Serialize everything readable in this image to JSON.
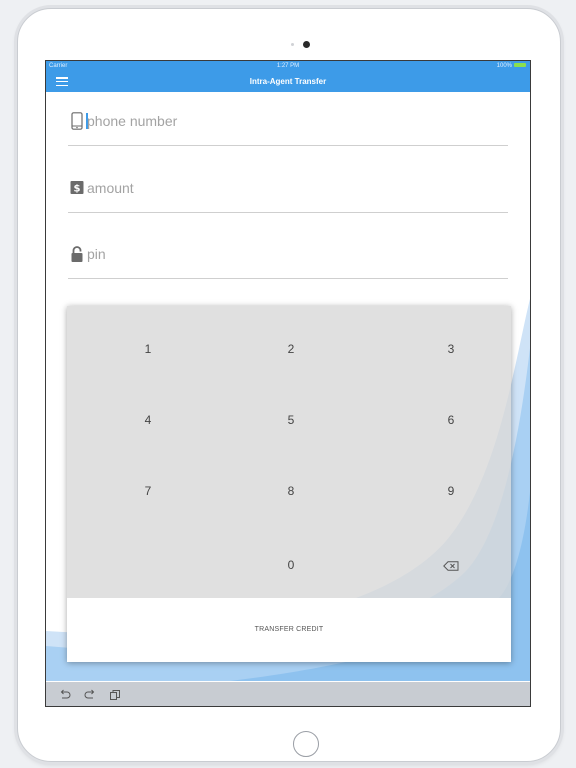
{
  "status_bar": {
    "carrier": "Carrier",
    "time": "1:27 PM",
    "battery": "100%"
  },
  "nav": {
    "title": "Intra-Agent Transfer",
    "menu_icon": "hamburger-menu-icon"
  },
  "form": {
    "phone": {
      "placeholder": "phone number",
      "value": "",
      "icon": "mobile-phone-icon"
    },
    "amount": {
      "placeholder": "amount",
      "value": "",
      "icon": "dollar-sign-icon"
    },
    "pin": {
      "placeholder": "pin",
      "value": "",
      "icon": "lock-icon"
    }
  },
  "keypad": {
    "keys": [
      "1",
      "2",
      "3",
      "4",
      "5",
      "6",
      "7",
      "8",
      "9",
      "0"
    ],
    "backspace_icon": "backspace-icon"
  },
  "transfer": {
    "label": "TRANSFER CREDIT"
  },
  "toolbar": {
    "icons": [
      "undo-icon",
      "redo-icon",
      "paste-icon"
    ]
  },
  "colors": {
    "accent": "#3d9be8",
    "wave_light": "#cfe3f7",
    "wave_mid": "#8ec2ef",
    "keypad_bg": "#d7d7d7",
    "toolbar_bg": "#c8ccd2"
  }
}
